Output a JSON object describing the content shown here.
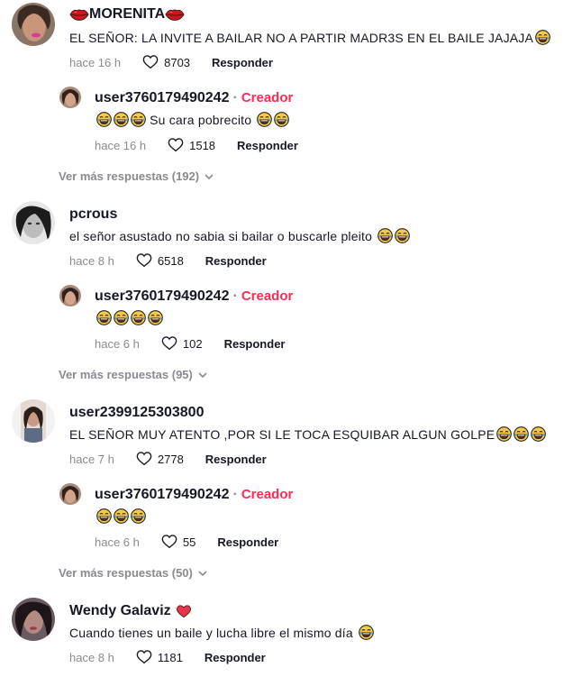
{
  "comments": [
    {
      "username": "MORENITA",
      "text": "EL SEÑOR: LA INVITE A BAILAR NO A PARTIR MADR3S EN EL BAILE JAJAJA",
      "time": "hace 16 h",
      "likes": "8703",
      "reply_label": "Responder",
      "reply": {
        "username": "user3760179490242",
        "creator_label": "Creador",
        "text": "Su cara pobrecito",
        "time": "hace 16 h",
        "likes": "1518",
        "reply_label": "Responder"
      },
      "more_replies": "Ver más respuestas (192)"
    },
    {
      "username": "pcrous",
      "text": "el señor asustado no sabia si bailar o buscarle pleito",
      "time": "hace 8 h",
      "likes": "6518",
      "reply_label": "Responder",
      "reply": {
        "username": "user3760179490242",
        "creator_label": "Creador",
        "text": "",
        "time": "hace 6 h",
        "likes": "102",
        "reply_label": "Responder"
      },
      "more_replies": "Ver más respuestas (95)"
    },
    {
      "username": "user2399125303800",
      "text": "EL SEÑOR MUY ATENTO ,POR SI LE TOCA ESQUIBAR ALGUN GOLPE",
      "time": "hace 7 h",
      "likes": "2778",
      "reply_label": "Responder",
      "reply": {
        "username": "user3760179490242",
        "creator_label": "Creador",
        "text": "",
        "time": "hace 6 h",
        "likes": "55",
        "reply_label": "Responder"
      },
      "more_replies": "Ver más respuestas (50)"
    },
    {
      "username": "Wendy Galaviz",
      "text": "Cuando tienes un baile y lucha libre el mismo día",
      "time": "hace 8 h",
      "likes": "1181",
      "reply_label": "Responder"
    }
  ],
  "icons": {
    "like": "heart-outline-icon",
    "more": "chevron-down-icon",
    "emoji": "laughing-tears-emoji",
    "lips": "lips-emoji",
    "badge": "sparkling-heart-emoji"
  },
  "colors": {
    "creator": "#fe2c55",
    "muted": "#8a8b91",
    "text": "#161823"
  }
}
